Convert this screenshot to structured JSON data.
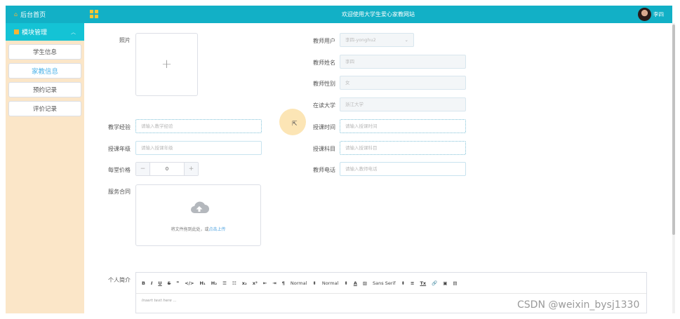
{
  "sidebar": {
    "home_label": "后台首页",
    "module_label": "模块管理",
    "items": [
      {
        "label": "学生信息"
      },
      {
        "label": "家教信息"
      },
      {
        "label": "预约记录"
      },
      {
        "label": "评价记录"
      }
    ]
  },
  "header": {
    "title": "欢迎使用大学生爱心家教网站",
    "username": "李四"
  },
  "form": {
    "photo_label": "照片",
    "photo_plus": "+",
    "teacher_user_label": "教师用户",
    "teacher_user_value": "李四-yonghu2",
    "teacher_name_label": "教师姓名",
    "teacher_name_value": "李四",
    "teacher_gender_label": "教师性别",
    "teacher_gender_value": "女",
    "university_label": "在读大学",
    "university_value": "浙江大学",
    "experience_label": "教学经验",
    "experience_placeholder": "请输入教学经验",
    "time_label": "授课时间",
    "time_placeholder": "请输入授课时间",
    "grade_label": "授课年级",
    "grade_placeholder": "请输入授课年级",
    "subject_label": "授课科目",
    "subject_placeholder": "请输入授课科目",
    "price_label": "每堂价格",
    "price_value": "0",
    "price_minus": "−",
    "price_plus": "+",
    "phone_label": "教师电话",
    "phone_placeholder": "请输入教师电话",
    "contract_label": "服务合同",
    "upload_text": "将文件拖到此处，或",
    "upload_link": "点击上传",
    "intro_label": "个人简介"
  },
  "editor": {
    "toolbar": [
      "B",
      "I",
      "U",
      "S",
      "❞",
      "</>",
      "H₁",
      "H₂",
      "☰",
      "☷",
      "x₂",
      "x²",
      "⇤",
      "⇥",
      "¶",
      "Normal",
      "⬍",
      "Normal",
      "⬍",
      "A",
      "▨",
      "Sans Serif",
      "⬍",
      "≡",
      "Tx",
      "🔗",
      "▣",
      "▤"
    ],
    "placeholder": "Insert text here ..."
  },
  "watermark": "CSDN @weixin_bysj1330",
  "icons": {
    "home": "home-icon",
    "module": "module-icon",
    "grid": "grid-icon",
    "cloud": "cloud-upload-icon"
  },
  "colors": {
    "header": "#12b0c6",
    "sidebar_bg": "#fbe6c8",
    "active_link": "#4fb3e8",
    "accent_yellow": "#f7b534"
  }
}
